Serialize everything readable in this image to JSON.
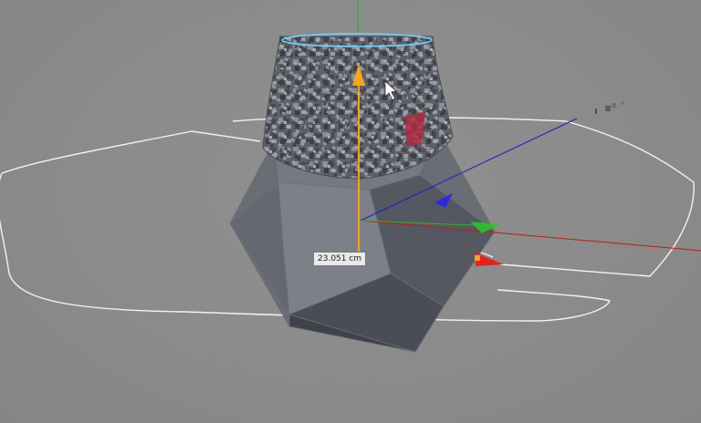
{
  "viewport": {
    "measurement_label": "23.051 cm",
    "colors": {
      "background": "#8a8a8a",
      "spline": "#ffffff",
      "axis_x": "#d01010",
      "axis_y": "#1fbf1f",
      "axis_z": "#1a1ad6",
      "move_y": "#f7a51a",
      "selection_ring": "#6fd6ff"
    },
    "icons": [
      "mouse-cursor-icon",
      "move-y-arrow-icon",
      "rotation-ring-icon"
    ]
  }
}
